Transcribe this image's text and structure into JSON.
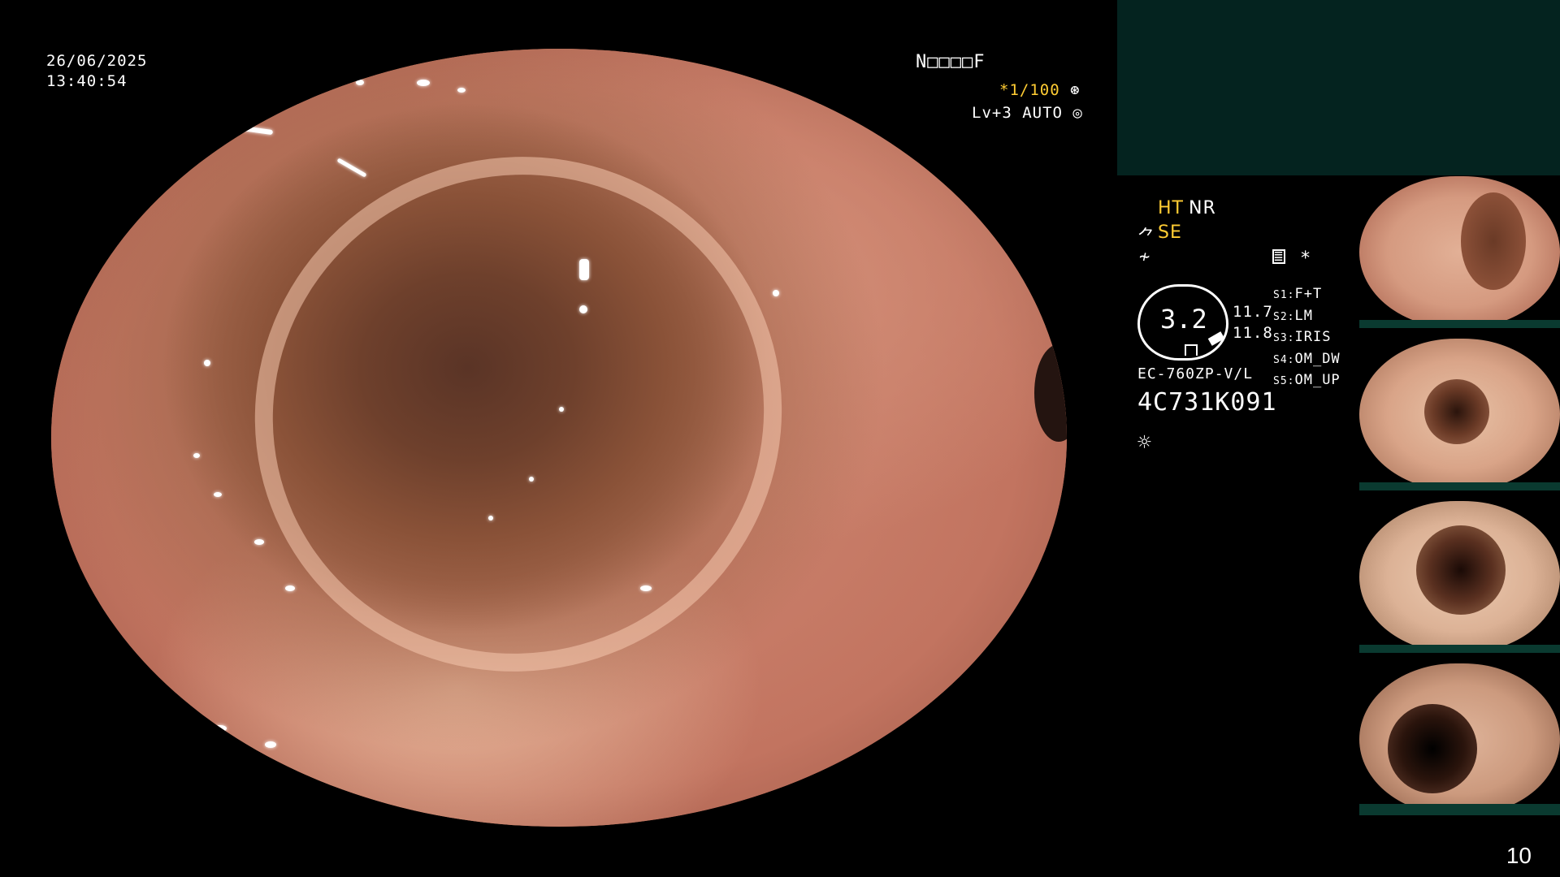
{
  "overlay": {
    "date": "26/06/2025",
    "time": "13:40:54",
    "patient_name": "N□□□□F",
    "shutter": "*1/100",
    "level": "Lv+3 AUTO"
  },
  "settings": {
    "ht": "HT",
    "nr": "NR",
    "se": "SE",
    "asterisk": "*",
    "gauge_value": "3.2",
    "gauge_r1": "11.7",
    "gauge_r2": "11.8",
    "scope_model": "EC-760ZP-V/L",
    "scope_serial": "4C731K091",
    "switches": [
      {
        "key": "S1:",
        "value": "F+T"
      },
      {
        "key": "S2:",
        "value": "LM"
      },
      {
        "key": "S3:",
        "value": "IRIS"
      },
      {
        "key": "S4:",
        "value": "OM_DW"
      },
      {
        "key": "S5:",
        "value": "OM_UP"
      }
    ]
  },
  "page_number": "10",
  "colors": {
    "accent_yellow": "#ffcc33",
    "panel_teal": "#04231f"
  }
}
